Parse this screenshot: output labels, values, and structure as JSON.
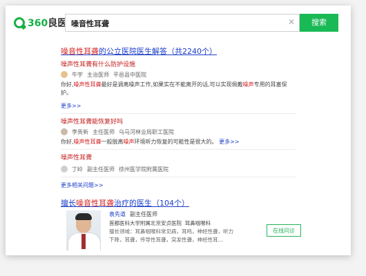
{
  "logo": {
    "num": "360",
    "text": "良医"
  },
  "search": {
    "value": "噪音性耳聋",
    "button": "搜索"
  },
  "qa": {
    "header_hl": "噪音性耳聋",
    "header_rest": "的公立医院医生解答（共2240个）",
    "items": [
      {
        "question": "噪声性耳聋有什么防护设施",
        "doctor": "牛宇",
        "role": "主治医师",
        "hospital": "平邑县中医院",
        "answer_pre": "你好,",
        "answer_hl1": "噪声性耳聋",
        "answer_mid": "最好是调离噪声工作,如果实在不能离开的话,可以实现佩戴",
        "answer_hl2": "噪声",
        "answer_post": "专用的耳塞保护。",
        "more": "更多>>"
      },
      {
        "question": "噪声性耳聋能恢复好吗",
        "doctor": "李贵新",
        "role": "主任医师",
        "hospital": "乌马河林业局职工医院",
        "answer_pre": "你好,",
        "answer_hl1": "噪声性耳聋",
        "answer_mid": "一般脱离",
        "answer_hl2": "噪声",
        "answer_post": "环境听力恢复的可能性是很大的。",
        "more": "更多>>"
      },
      {
        "question": "噪声性耳聋",
        "doctor": "丁岭",
        "role": "副主任医师",
        "hospital": "徐州医学院附属医院"
      }
    ],
    "more_questions": "更多相关问题>>"
  },
  "doctors": {
    "header_pre": "擅长",
    "header_hl": "噪音性耳聋",
    "header_rest": "治疗的医生（104个）",
    "name": "袁先道",
    "title": "副主任医师",
    "hospital": "首都医科大学附属北京安贞医院",
    "dept": "耳鼻咽喉科",
    "desc1": "擅长领域：耳鼻咽喉科常见病，耳鸣，神经性聋，听力",
    "desc2": "下降，耳聋，传导性耳聋，突发性聋，神经性耳...",
    "consult": "在线问诊"
  }
}
